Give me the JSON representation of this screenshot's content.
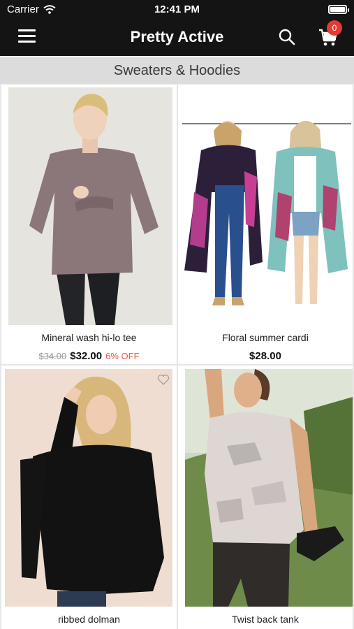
{
  "status_bar": {
    "carrier": "Carrier",
    "time": "12:41 PM"
  },
  "nav": {
    "title": "Pretty Active",
    "cart_count": "0"
  },
  "section": {
    "title": "Sweaters & Hoodies"
  },
  "products": [
    {
      "name": "Mineral wash hi-lo tee",
      "old_price": "$34.00",
      "price": "$32.00",
      "discount": "6% OFF"
    },
    {
      "name": "Floral summer cardi",
      "price": "$28.00"
    },
    {
      "name": "ribbed dolman"
    },
    {
      "name": "Twist back tank"
    }
  ],
  "colors": {
    "nav_bg": "#141414",
    "badge": "#e53935",
    "discount": "#e8524a"
  },
  "icons": [
    "wifi-icon",
    "battery-icon",
    "menu-icon",
    "search-icon",
    "cart-icon",
    "heart-icon"
  ]
}
